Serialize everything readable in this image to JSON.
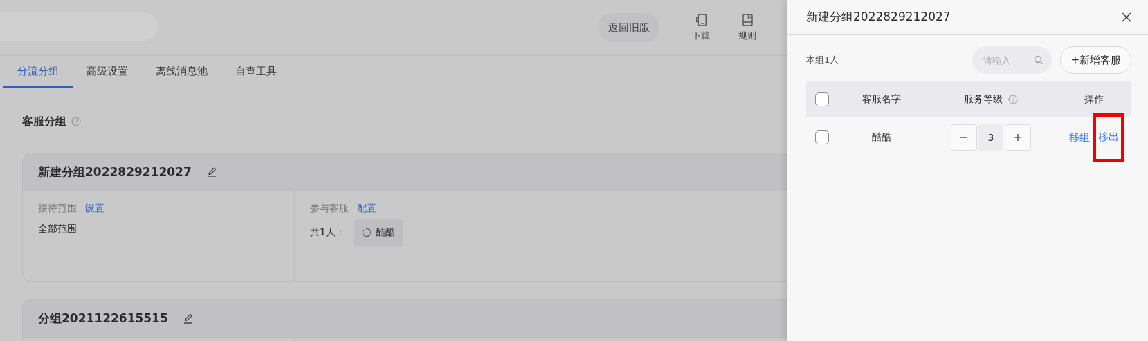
{
  "header": {
    "old_version_button": "返回旧版",
    "tools": [
      {
        "label": "下载",
        "kind": "device"
      },
      {
        "label": "规则",
        "kind": "book"
      }
    ]
  },
  "tabs": [
    {
      "label": "分流分组",
      "selected": true
    },
    {
      "label": "高级设置",
      "selected": false
    },
    {
      "label": "离线消息池",
      "selected": false
    },
    {
      "label": "自查工具",
      "selected": false
    }
  ],
  "section": {
    "title": "客服分组"
  },
  "groups": [
    {
      "name": "新建分组2022829212027",
      "scope_label": "接待范围",
      "scope_link": "设置",
      "scope_value": "全部范围",
      "agents_label": "参与客服",
      "agents_link": "配置",
      "agents_count": "共1人：",
      "agents": [
        "酷酷"
      ]
    },
    {
      "name": "分组2021122615515"
    }
  ],
  "drawer": {
    "title": "新建分组2022829212027",
    "count": "本组1人",
    "search_placeholder": "请输入",
    "add_button": "+新增客服",
    "header_checked": false,
    "columns": [
      "客服名字",
      "服务等级",
      "操作"
    ],
    "rows": [
      {
        "name": "酷酷",
        "checked": false,
        "service_level": "3",
        "actions": [
          {
            "label": "移组",
            "highlighted": false
          },
          {
            "label": "移出",
            "highlighted": true
          }
        ]
      }
    ]
  }
}
